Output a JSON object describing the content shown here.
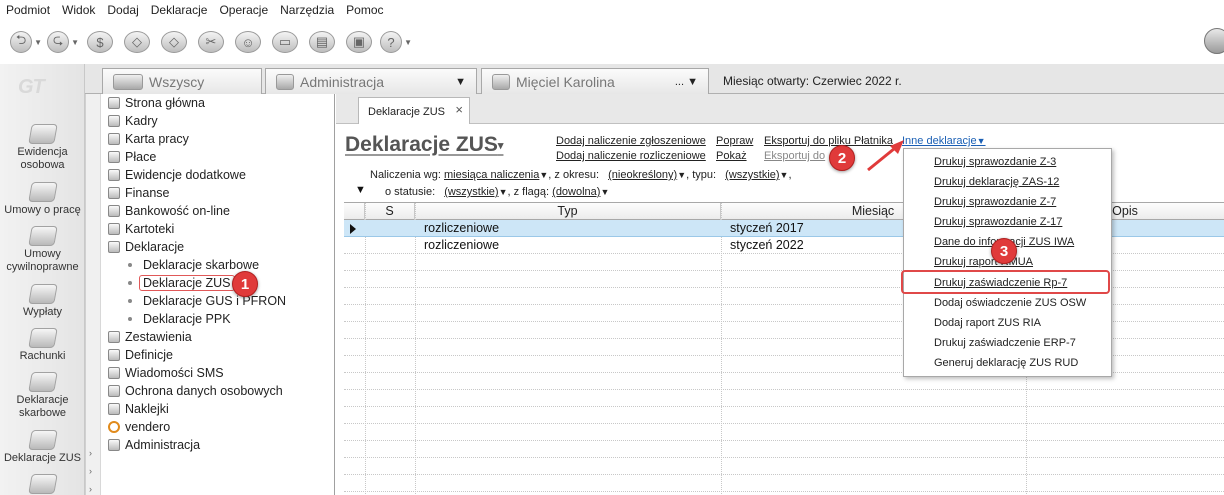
{
  "menubar": [
    "Podmiot",
    "Widok",
    "Dodaj",
    "Deklaracje",
    "Operacje",
    "Narzędzia",
    "Pomoc"
  ],
  "logo": "GT",
  "leftnav": [
    {
      "label": "Ewidencja osobowa",
      "icon": "people-icon"
    },
    {
      "label": "Umowy o pracę",
      "icon": "contract-icon"
    },
    {
      "label": "Umowy cywilnoprawne",
      "icon": "civil-contract-icon"
    },
    {
      "label": "Wypłaty",
      "icon": "payments-icon"
    },
    {
      "label": "Rachunki",
      "icon": "bills-icon"
    },
    {
      "label": "Deklaracje skarbowe",
      "icon": "tax-declarations-icon"
    },
    {
      "label": "Deklaracje ZUS",
      "icon": "zus-icon"
    }
  ],
  "context_tabs": {
    "all": "Wszyscy",
    "admin": "Administracja",
    "person": "Mięciel Karolina",
    "person_more": "...",
    "month": "Miesiąc otwarty: Czerwiec 2022 r."
  },
  "tree": {
    "items": [
      "Strona główna",
      "Kadry",
      "Karta pracy",
      "Płace",
      "Ewidencje dodatkowe",
      "Finanse",
      "Bankowość on-line",
      "Kartoteki",
      "Deklaracje"
    ],
    "sub": [
      "Deklaracje skarbowe",
      "Deklaracje ZUS",
      "Deklaracje GUS i PFRON",
      "Deklaracje PPK"
    ],
    "after": [
      "Zestawienia",
      "Definicje",
      "Wiadomości SMS",
      "Ochrona danych osobowych",
      "Naklejki",
      "vendero",
      "Administracja"
    ]
  },
  "doc_tab": "Deklaracje ZUS",
  "page_title": "Deklaracje ZUS",
  "links": {
    "add_zgl": "Dodaj naliczenie zgłoszeniowe",
    "add_roz": "Dodaj naliczenie rozliczeniowe",
    "popraw": "Popraw",
    "pokaz": "Pokaż",
    "export1": "Eksportuj do pliku Płatnika",
    "export2": "Eksportuj do",
    "other": "Inne deklaracje"
  },
  "filters": {
    "label_wg": "Naliczenia wg:",
    "wg_value": "miesiąca naliczenia",
    "label_okres": ", z okresu:",
    "okres_value": "(nieokreślony)",
    "label_typ": ", typu:",
    "typ_value": "(wszystkie)",
    "tail": ",",
    "label_status": "o statusie:",
    "status_value": "(wszystkie)",
    "label_flaga": ", z flagą:",
    "flaga_value": "(dowolna)"
  },
  "table": {
    "columns": [
      "S",
      "Typ",
      "Miesiąc",
      "Opis"
    ],
    "rows": [
      {
        "typ": "rozliczeniowe",
        "miesiac": "styczeń 2017"
      },
      {
        "typ": "rozliczeniowe",
        "miesiac": "styczeń 2022"
      }
    ]
  },
  "dropdown": [
    "Drukuj sprawozdanie Z-3",
    "Drukuj deklarację ZAS-12",
    "Drukuj sprawozdanie Z-7",
    "Drukuj sprawozdanie Z-17",
    "Dane do informacji ZUS IWA",
    "Drukuj raport RMUA",
    "Drukuj zaświadczenie Rp-7",
    "Dodaj oświadczenie ZUS OSW",
    "Dodaj raport ZUS RIA",
    "Drukuj zaświadczenie ERP-7",
    "Generuj deklarację ZUS RUD"
  ],
  "callouts": [
    "1",
    "2",
    "3"
  ],
  "colors": {
    "accent": "#e03a3a",
    "selection": "#cde6f7",
    "link_blue": "#1a5fb4"
  }
}
